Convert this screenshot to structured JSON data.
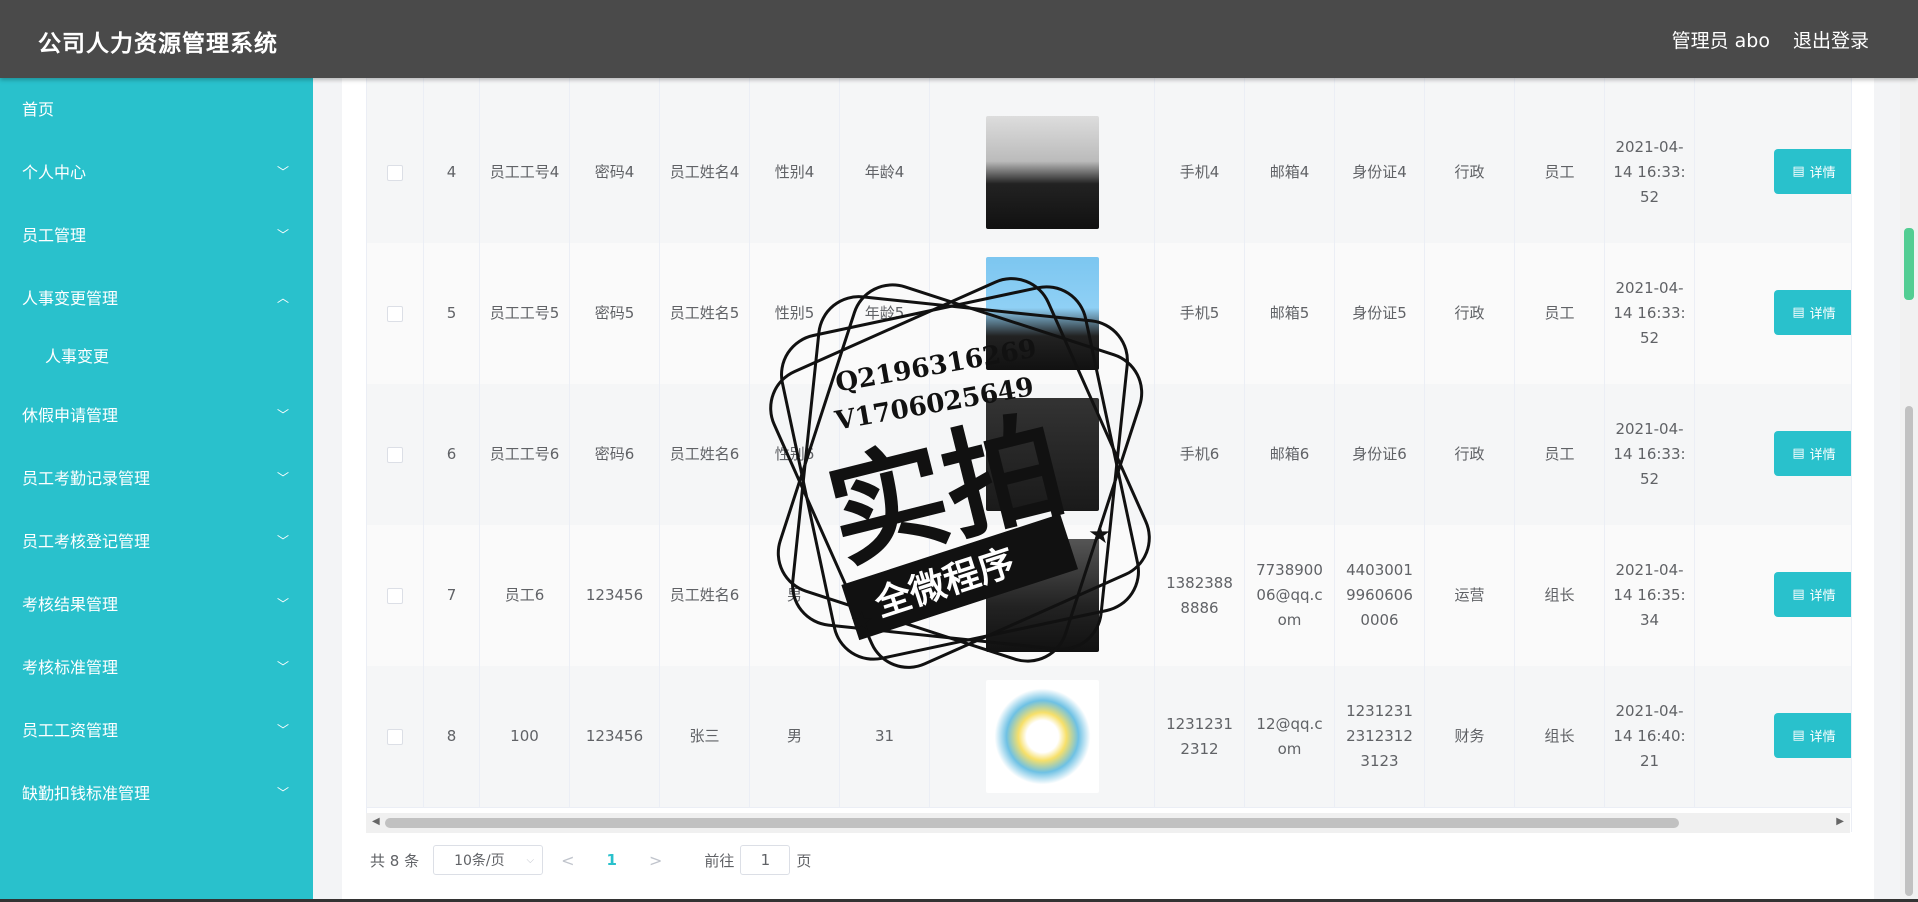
{
  "header": {
    "title": "公司人力资源管理系统",
    "user": "管理员 abo",
    "logout": "退出登录"
  },
  "sidebar": {
    "items": [
      {
        "label": "首页",
        "expandable": false
      },
      {
        "label": "个人中心",
        "expandable": true,
        "expanded": false
      },
      {
        "label": "员工管理",
        "expandable": true,
        "expanded": false
      },
      {
        "label": "人事变更管理",
        "expandable": true,
        "expanded": true
      },
      {
        "label": "人事变更",
        "sub": true
      },
      {
        "label": "休假申请管理",
        "expandable": true,
        "expanded": false
      },
      {
        "label": "员工考勤记录管理",
        "expandable": true,
        "expanded": false
      },
      {
        "label": "员工考核登记管理",
        "expandable": true,
        "expanded": false
      },
      {
        "label": "考核结果管理",
        "expandable": true,
        "expanded": false
      },
      {
        "label": "考核标准管理",
        "expandable": true,
        "expanded": false
      },
      {
        "label": "员工工资管理",
        "expandable": true,
        "expanded": false
      },
      {
        "label": "缺勤扣钱标准管理",
        "expandable": true,
        "expanded": false
      }
    ]
  },
  "table": {
    "rows": [
      {
        "index": "4",
        "emp_no": "员工工号4",
        "password": "密码4",
        "name": "员工姓名4",
        "gender": "性别4",
        "age": "年龄4",
        "photo": "man-suit",
        "phone": "手机4",
        "email": "邮箱4",
        "id_card": "身份证4",
        "dept": "行政",
        "position": "员工",
        "time": "2021-04-14 16:33:52"
      },
      {
        "index": "5",
        "emp_no": "员工工号5",
        "password": "密码5",
        "name": "员工姓名5",
        "gender": "性别5",
        "age": "年龄5",
        "photo": "woman-blue",
        "phone": "手机5",
        "email": "邮箱5",
        "id_card": "身份证5",
        "dept": "行政",
        "position": "员工",
        "time": "2021-04-14 16:33:52"
      },
      {
        "index": "6",
        "emp_no": "员工工号6",
        "password": "密码6",
        "name": "员工姓名6",
        "gender": "性别6",
        "age": "",
        "photo": "man-dark",
        "phone": "手机6",
        "email": "邮箱6",
        "id_card": "身份证6",
        "dept": "行政",
        "position": "员工",
        "time": "2021-04-14 16:33:52"
      },
      {
        "index": "7",
        "emp_no": "员工6",
        "password": "123456",
        "name": "员工姓名6",
        "gender": "男",
        "age": "6",
        "photo": "man-dark2",
        "phone": "13823888886",
        "email": "773890006@qq.com",
        "id_card": "440300199606060006",
        "dept": "运营",
        "position": "组长",
        "time": "2021-04-14 16:35:34"
      },
      {
        "index": "8",
        "emp_no": "100",
        "password": "123456",
        "name": "张三",
        "gender": "男",
        "age": "31",
        "photo": "colorful-swirl",
        "phone": "12312312312",
        "email": "12@qq.com",
        "id_card": "123123123123123123",
        "dept": "财务",
        "position": "组长",
        "time": "2021-04-14 16:40:21"
      }
    ],
    "detail_label": "详情"
  },
  "pagination": {
    "total": "共 8 条",
    "page_size": "10条/页",
    "current_page": "1",
    "goto_label": "前往",
    "goto_value": "1",
    "page_suffix": "页"
  },
  "watermark": {
    "line1": "Q2196316269",
    "line2": "V1706025649",
    "big": "实拍",
    "banner": "全微程序"
  },
  "colors": {
    "sidebar": "#29c1cc",
    "header": "#4a4a4a",
    "detail_button": "#29c1cc",
    "edit_button": "#7b6db5"
  }
}
